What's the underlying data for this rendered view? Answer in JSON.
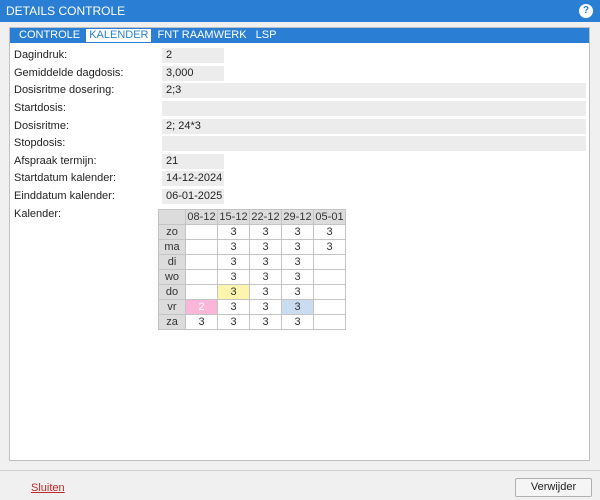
{
  "window": {
    "title": "DETAILS CONTROLE",
    "help_label": "?"
  },
  "tabs": [
    {
      "label": "CONTROLE",
      "active": false
    },
    {
      "label": "KALENDER",
      "active": true
    },
    {
      "label": "FNT RAAMWERK",
      "active": false
    },
    {
      "label": "LSP",
      "active": false
    }
  ],
  "fields": {
    "dagindruk": {
      "label": "Dagindruk:",
      "value": "2"
    },
    "gemiddelde_dagdosis": {
      "label": "Gemiddelde dagdosis:",
      "value": "3,000"
    },
    "dosisritme_dosering": {
      "label": "Dosisritme dosering:",
      "value": "2;3"
    },
    "startdosis": {
      "label": "Startdosis:",
      "value": ""
    },
    "dosisritme": {
      "label": "Dosisritme:",
      "value": "2; 24*3"
    },
    "stopdosis": {
      "label": "Stopdosis:",
      "value": ""
    },
    "afspraak_termijn": {
      "label": "Afspraak termijn:",
      "value": "21"
    },
    "startdatum_kalender": {
      "label": "Startdatum kalender:",
      "value": "14-12-2024"
    },
    "einddatum_kalender": {
      "label": "Einddatum kalender:",
      "value": "06-01-2025"
    },
    "kalender": {
      "label": "Kalender:"
    }
  },
  "calendar": {
    "weeks": [
      "08-12",
      "15-12",
      "22-12",
      "29-12",
      "05-01"
    ],
    "rows": [
      {
        "day": "zo",
        "cells": [
          "",
          "3",
          "3",
          "3",
          "3"
        ]
      },
      {
        "day": "ma",
        "cells": [
          "",
          "3",
          "3",
          "3",
          "3"
        ]
      },
      {
        "day": "di",
        "cells": [
          "",
          "3",
          "3",
          "3",
          ""
        ]
      },
      {
        "day": "wo",
        "cells": [
          "",
          "3",
          "3",
          "3",
          ""
        ]
      },
      {
        "day": "do",
        "cells": [
          "",
          "3",
          "3",
          "3",
          ""
        ]
      },
      {
        "day": "vr",
        "cells": [
          "2",
          "3",
          "3",
          "3",
          ""
        ]
      },
      {
        "day": "za",
        "cells": [
          "3",
          "3",
          "3",
          "3",
          ""
        ]
      }
    ],
    "highlight_colors": {
      "start": "#f9b6d8",
      "today": "#fbf5ae",
      "end": "#c9dcf0"
    }
  },
  "footer": {
    "close_label": "Sluiten",
    "delete_label": "Verwijder"
  },
  "colors": {
    "accent": "#2a7fd4",
    "close_link": "#c0282c"
  }
}
